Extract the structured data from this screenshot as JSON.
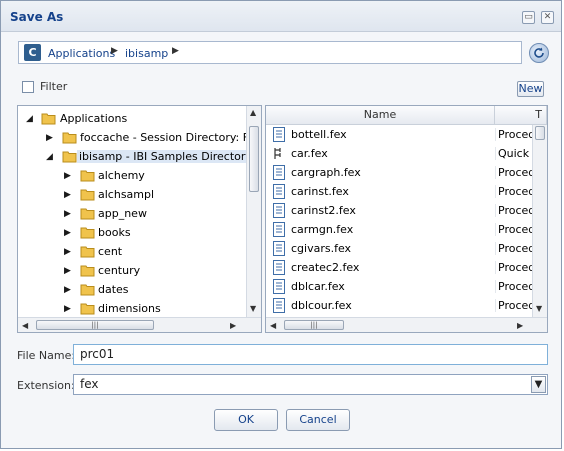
{
  "window": {
    "title": "Save As"
  },
  "breadcrumb": {
    "items": [
      "Applications",
      "ibisamp"
    ]
  },
  "filter": {
    "label": "Filter",
    "checked": false
  },
  "toolbar": {
    "new_label": "New"
  },
  "tree": {
    "root": "Applications",
    "nodes": [
      {
        "label": "foccache - Session Directory: Files",
        "expanded": false
      },
      {
        "label": "ibisamp - IBI Samples Directory for",
        "expanded": true,
        "selected": true
      },
      {
        "label": "alchemy"
      },
      {
        "label": "alchsampl"
      },
      {
        "label": "app_new"
      },
      {
        "label": "books"
      },
      {
        "label": "cent"
      },
      {
        "label": "century"
      },
      {
        "label": "dates"
      },
      {
        "label": "dimensions"
      }
    ]
  },
  "file_list": {
    "columns": [
      "Name",
      "T"
    ],
    "rows": [
      {
        "name": "bottell.fex",
        "type": "Proced",
        "icon": "procedure-icon"
      },
      {
        "name": "car.fex",
        "type": "Quick C",
        "icon": "quick-chart-icon"
      },
      {
        "name": "cargraph.fex",
        "type": "Proced",
        "icon": "procedure-icon"
      },
      {
        "name": "carinst.fex",
        "type": "Proced",
        "icon": "procedure-icon"
      },
      {
        "name": "carinst2.fex",
        "type": "Proced",
        "icon": "procedure-icon"
      },
      {
        "name": "carmgn.fex",
        "type": "Proced",
        "icon": "procedure-icon"
      },
      {
        "name": "cgivars.fex",
        "type": "Proced",
        "icon": "procedure-icon"
      },
      {
        "name": "createc2.fex",
        "type": "Proced",
        "icon": "procedure-icon"
      },
      {
        "name": "dblcar.fex",
        "type": "Proced",
        "icon": "procedure-icon"
      },
      {
        "name": "dblcour.fex",
        "type": "Proced",
        "icon": "procedure-icon"
      }
    ]
  },
  "form": {
    "file_name_label": "File Name:",
    "file_name_value": "prc01",
    "extension_label": "Extension:",
    "extension_value": "fex"
  },
  "buttons": {
    "ok": "OK",
    "cancel": "Cancel"
  },
  "colors": {
    "accent": "#15428b",
    "folder": "#f0c34c",
    "selection": "#dce7f5"
  }
}
